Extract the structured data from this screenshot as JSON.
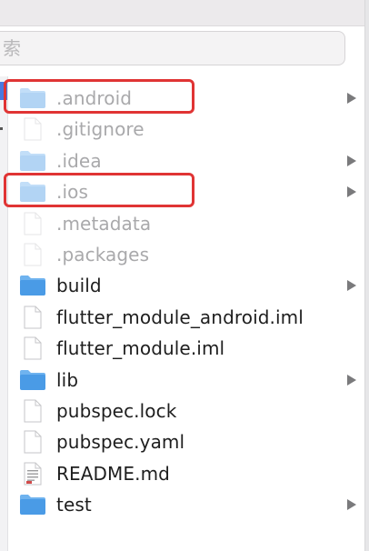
{
  "search": {
    "placeholder_fragment": "索"
  },
  "files": [
    {
      "name": ".android",
      "type": "folder",
      "hidden": true,
      "expandable": true,
      "highlighted": true
    },
    {
      "name": ".gitignore",
      "type": "file",
      "hidden": true,
      "expandable": false,
      "highlighted": false
    },
    {
      "name": ".idea",
      "type": "folder",
      "hidden": true,
      "expandable": true,
      "highlighted": false
    },
    {
      "name": ".ios",
      "type": "folder",
      "hidden": true,
      "expandable": true,
      "highlighted": true
    },
    {
      "name": ".metadata",
      "type": "file",
      "hidden": true,
      "expandable": false,
      "highlighted": false
    },
    {
      "name": ".packages",
      "type": "file",
      "hidden": true,
      "expandable": false,
      "highlighted": false
    },
    {
      "name": "build",
      "type": "folder",
      "hidden": false,
      "expandable": true,
      "highlighted": false
    },
    {
      "name": "flutter_module_android.iml",
      "type": "file",
      "hidden": false,
      "expandable": false,
      "highlighted": false
    },
    {
      "name": "flutter_module.iml",
      "type": "file",
      "hidden": false,
      "expandable": false,
      "highlighted": false
    },
    {
      "name": "lib",
      "type": "folder",
      "hidden": false,
      "expandable": true,
      "highlighted": false
    },
    {
      "name": "pubspec.lock",
      "type": "file",
      "hidden": false,
      "expandable": false,
      "highlighted": false
    },
    {
      "name": "pubspec.yaml",
      "type": "file",
      "hidden": false,
      "expandable": false,
      "highlighted": false
    },
    {
      "name": "README.md",
      "type": "markdown",
      "hidden": false,
      "expandable": false,
      "highlighted": false
    },
    {
      "name": "test",
      "type": "folder",
      "hidden": false,
      "expandable": true,
      "highlighted": false
    }
  ],
  "colors": {
    "folder": "#4a9be6",
    "folder_tab": "#6fb3ef",
    "highlight": "#e03434",
    "accent": "#4a79e0"
  }
}
